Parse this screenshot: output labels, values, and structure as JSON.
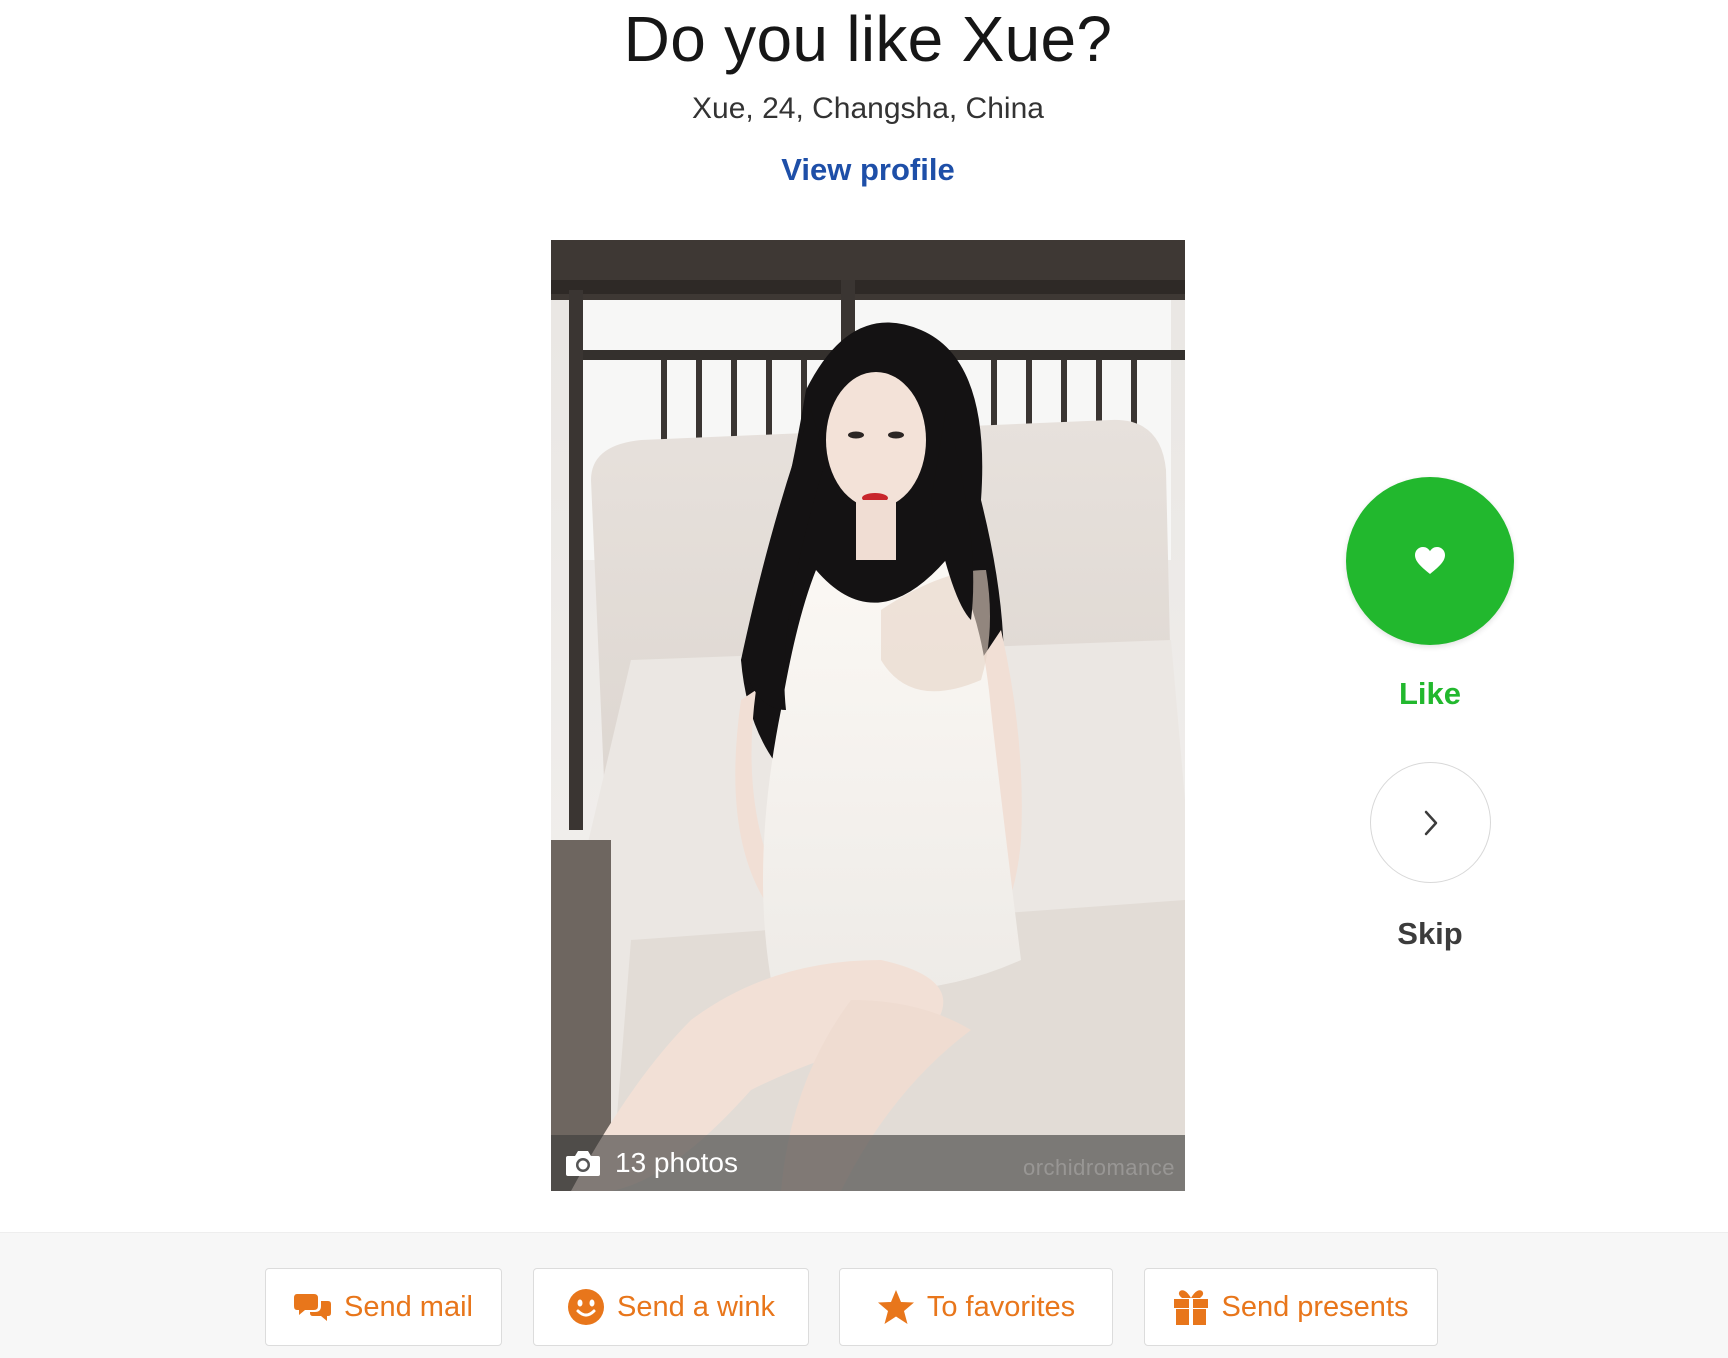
{
  "header": {
    "title": "Do you like Xue?",
    "subtitle": "Xue, 24, Changsha, China",
    "view_profile_label": "View profile"
  },
  "photo": {
    "count_label": "13 photos",
    "watermark": "orchidromance"
  },
  "side_actions": {
    "like_label": "Like",
    "skip_label": "Skip"
  },
  "actions": [
    {
      "label": "Send mail",
      "icon": "chat-bubbles-icon"
    },
    {
      "label": "Send a wink",
      "icon": "smiley-icon"
    },
    {
      "label": "To favorites",
      "icon": "star-icon"
    },
    {
      "label": "Send presents",
      "icon": "gift-icon"
    }
  ],
  "colors": {
    "like_green": "#22b82e",
    "link_blue": "#1e4fa8",
    "action_orange": "#e8761b"
  }
}
